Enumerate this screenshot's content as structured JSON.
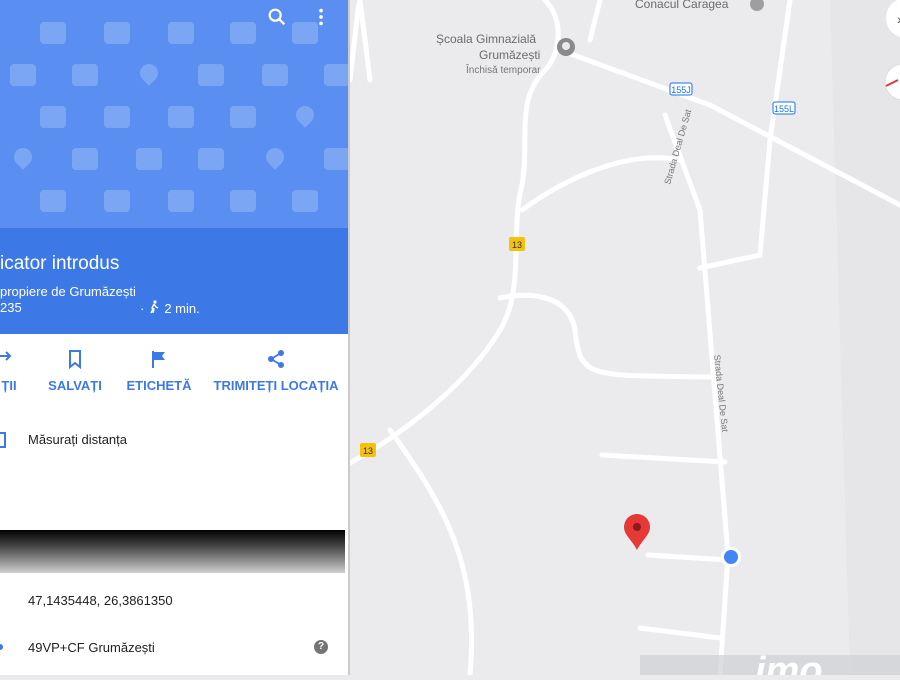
{
  "panel": {
    "title": "icator introdus",
    "subtitle": "propiere de Grumăzești",
    "code": "235",
    "walk_time": "2 min.",
    "actions": [
      {
        "label": "ȚII"
      },
      {
        "label": "SALVAȚI"
      },
      {
        "label": "ETICHETĂ"
      },
      {
        "label": "TRIMITEȚI LOCAȚIA"
      }
    ],
    "measure_label": "Măsurați distanța",
    "coordinates": "47,1435448, 26,3861350",
    "plus_code": "49VP+CF Grumăzești"
  },
  "map": {
    "labels": {
      "manor": "Conacul Caragea",
      "school_line1": "Școala Gimnazială",
      "school_line2": "Grumăzești",
      "school_status": "Închisă temporar",
      "street1": "Strada Deal De Sat",
      "street2": "Strada Deal De Sat"
    },
    "road_shields": [
      "155J",
      "155L",
      "13",
      "13"
    ],
    "watermark": "imo"
  },
  "colors": {
    "hero": "#5a8ef0",
    "titlebar": "#3d79e6",
    "accent": "#3d79e6",
    "pin": "#e53935",
    "location_dot": "#4285f4"
  }
}
